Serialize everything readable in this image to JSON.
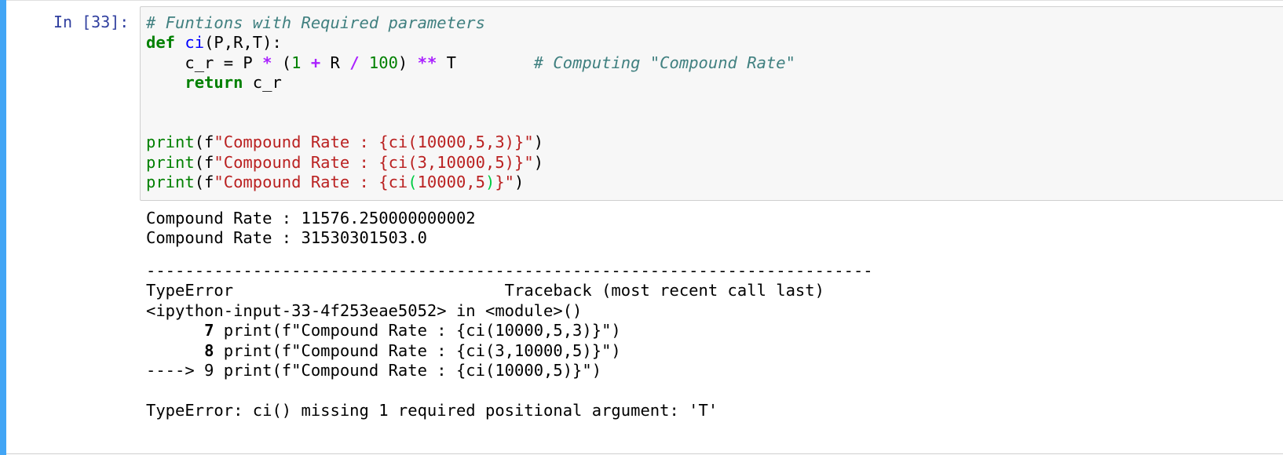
{
  "cell": {
    "prompt": "In [33]:",
    "code": {
      "comment_title": "# Funtions with Required parameters",
      "kw_def": "def",
      "func_name": "ci",
      "signature": "(P,R,T):",
      "body_lhs": "    c_r = P ",
      "op_mul": "*",
      "paren_open": " (",
      "num_1": "1",
      "op_plus": "+",
      "r_var": " R ",
      "op_div": "/",
      "num_100": "100",
      "paren_close": ") ",
      "op_pow": "**",
      "t_var": " T        ",
      "comment_compute": "# Computing \"Compound Rate\"",
      "indent": "    ",
      "kw_return": "return",
      "return_val": " c_r",
      "print_fn": "print",
      "f_prefix": "(f",
      "call1_str": "\"Compound Rate : {ci(10000,5,3)}\"",
      "call2_str": "\"Compound Rate : {ci(3,10000,5)}\"",
      "call3_str_a": "\"Compound Rate : {ci",
      "call3_paren_open": "(",
      "call3_args": "10000,5",
      "call3_paren_close": ")",
      "call3_str_b": "}\"",
      "close_paren": ")"
    },
    "output": {
      "line1": "Compound Rate : 11576.250000000002",
      "line2": "Compound Rate : 31530301503.0"
    },
    "traceback": {
      "separator": "---------------------------------------------------------------------------",
      "error_type": "TypeError",
      "header_right": "                            Traceback (most recent call last)",
      "location": "<ipython-input-33-4f253eae5052> in <module>()",
      "line7_num": "7",
      "line7_code": " print(f\"Compound Rate : {ci(10000,5,3)}\")",
      "line8_num": "8",
      "line8_code": " print(f\"Compound Rate : {ci(3,10000,5)}\")",
      "line9_arrow": "----> 9",
      "line9_code": " print(f\"Compound Rate : {ci(10000,5)}\")",
      "error_message": "TypeError: ci() missing 1 required positional argument: 'T'"
    }
  },
  "colors": {
    "cell_bar": "#42a5f5",
    "prompt": "#303f9f",
    "comment": "#408080",
    "keyword": "#008000",
    "function_name": "#0000ff",
    "operator": "#aa22ff",
    "string": "#ba2121"
  }
}
